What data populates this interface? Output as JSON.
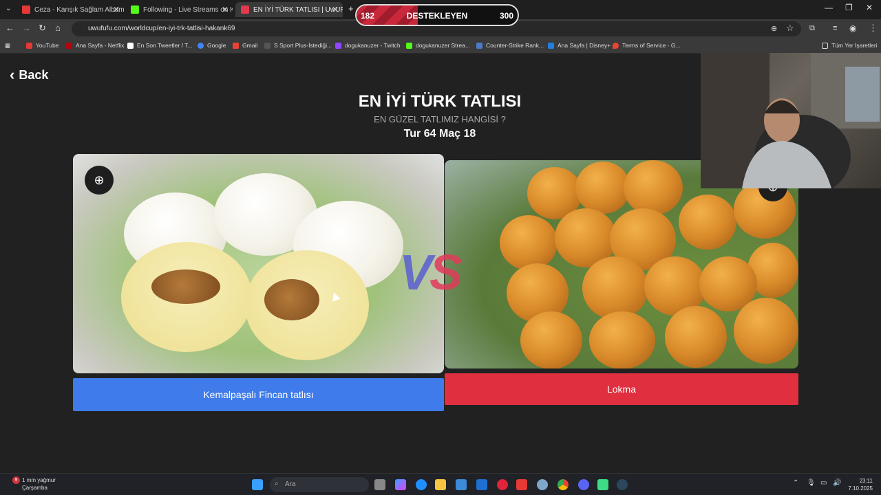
{
  "browser": {
    "tabs": [
      {
        "label": "Ceza - Karışık Sağlam Albüm",
        "favicon_color": "#e53935"
      },
      {
        "label": "Following - Live Streams on Kick",
        "favicon_color": "#53fc18"
      },
      {
        "label": "EN İYİ TÜRK TATLISI | UwUFUFU",
        "favicon_color": "#e23a4a"
      }
    ],
    "url": "uwufufu.com/worldcup/en-iyi-trk-tatlisi-hakank69",
    "bookmarks": [
      {
        "label": "YouTube",
        "color": "#e53935"
      },
      {
        "label": "Ana Sayfa - Netflix",
        "color": "#b1060f"
      },
      {
        "label": "En Son Tweetler / T...",
        "color": "#ffffff"
      },
      {
        "label": "Google",
        "color": "#4285f4"
      },
      {
        "label": "Gmail",
        "color": "#ea4335"
      },
      {
        "label": "S Sport Plus-İstediği...",
        "color": "#222222"
      },
      {
        "label": "dogukanuzer - Twitch",
        "color": "#9146ff"
      },
      {
        "label": "dogukanuzer Strea...",
        "color": "#53fc18"
      },
      {
        "label": "Counter-Strike Rank...",
        "color": "#4c7ac9"
      },
      {
        "label": "Ana Sayfa | Disney+",
        "color": "#1f80e0"
      },
      {
        "label": "Terms of Service - G...",
        "color": "#ea4335"
      }
    ],
    "all_bookmarks": "Tüm Yer İşaretleri"
  },
  "page": {
    "back_label": "Back",
    "title": "EN İYİ TÜRK TATLISI",
    "subtitle": "EN GÜZEL TATLIMIZ HANGİSİ ?",
    "round": "Tur 64 Maç 18",
    "vs_v": "V",
    "vs_s": "S",
    "left_choice": "Kemalpaşalı Fincan tatlısı",
    "right_choice": "Lokma"
  },
  "overlay": {
    "support_left": "182",
    "support_label": "DESTEKLEYEN",
    "support_right": "300",
    "support_fill_fraction": 0.38
  },
  "taskbar": {
    "weather_badge": "9",
    "weather_line1": "1 mm yağmur",
    "weather_line2": "Çarşamba",
    "search_placeholder": "Ara",
    "time": "23:11",
    "date": "7.10.2025"
  },
  "colors": {
    "left_button": "#3f7bea",
    "right_button": "#e0303f"
  }
}
